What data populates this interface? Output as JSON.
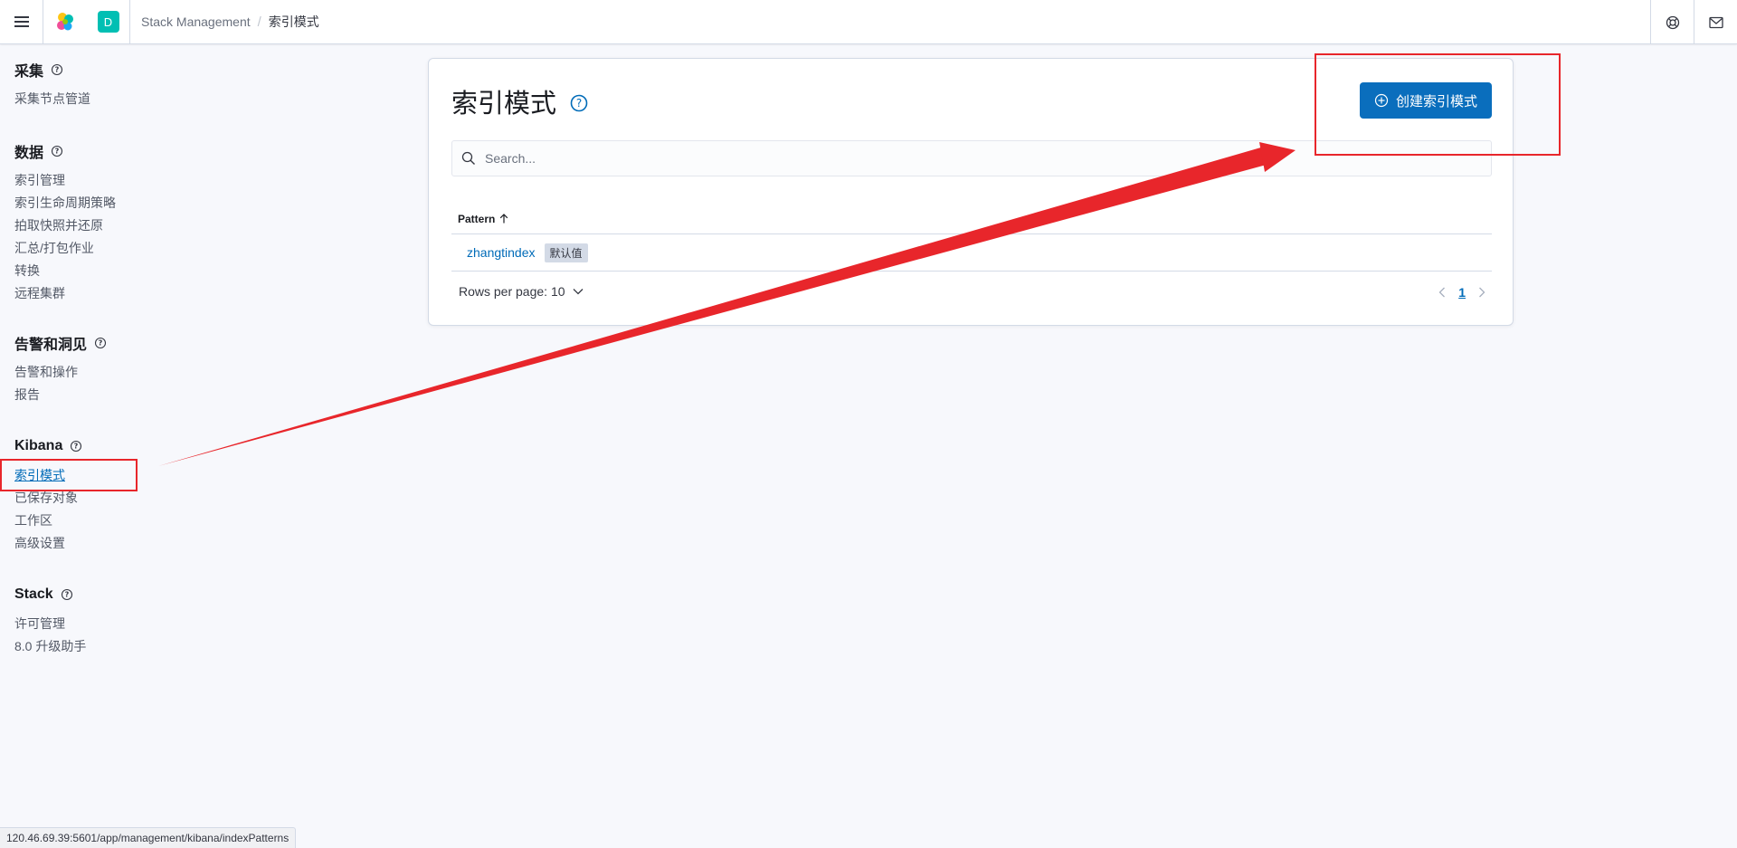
{
  "header": {
    "space_initial": "D",
    "breadcrumb_root": "Stack Management",
    "breadcrumb_separator": "/",
    "breadcrumb_current": "索引模式"
  },
  "sidebar": {
    "groups": [
      {
        "title": "采集",
        "items": [
          "采集节点管道"
        ]
      },
      {
        "title": "数据",
        "items": [
          "索引管理",
          "索引生命周期策略",
          "拍取快照并还原",
          "汇总/打包作业",
          "转换",
          "远程集群"
        ]
      },
      {
        "title": "告警和洞见",
        "items": [
          "告警和操作",
          "报告"
        ]
      },
      {
        "title": "Kibana",
        "items": [
          "索引模式",
          "已保存对象",
          "工作区",
          "高级设置"
        ]
      },
      {
        "title": "Stack",
        "items": [
          "许可管理",
          "8.0 升级助手"
        ]
      }
    ],
    "active_item": "索引模式"
  },
  "main": {
    "title": "索引模式",
    "create_button_label": "创建索引模式",
    "search_placeholder": "Search...",
    "table": {
      "column_header": "Pattern",
      "rows": [
        {
          "pattern": "zhangtindex",
          "badge": "默认值"
        }
      ]
    },
    "rows_per_page_label": "Rows per page: 10",
    "current_page": "1"
  },
  "status_bar": {
    "url": "120.46.69.39:5601/app/management/kibana/indexPatterns"
  },
  "colors": {
    "primary": "#0a6ebd",
    "link": "#006bb8",
    "annotation": "#e8262b",
    "space_avatar": "#00bfb3"
  }
}
